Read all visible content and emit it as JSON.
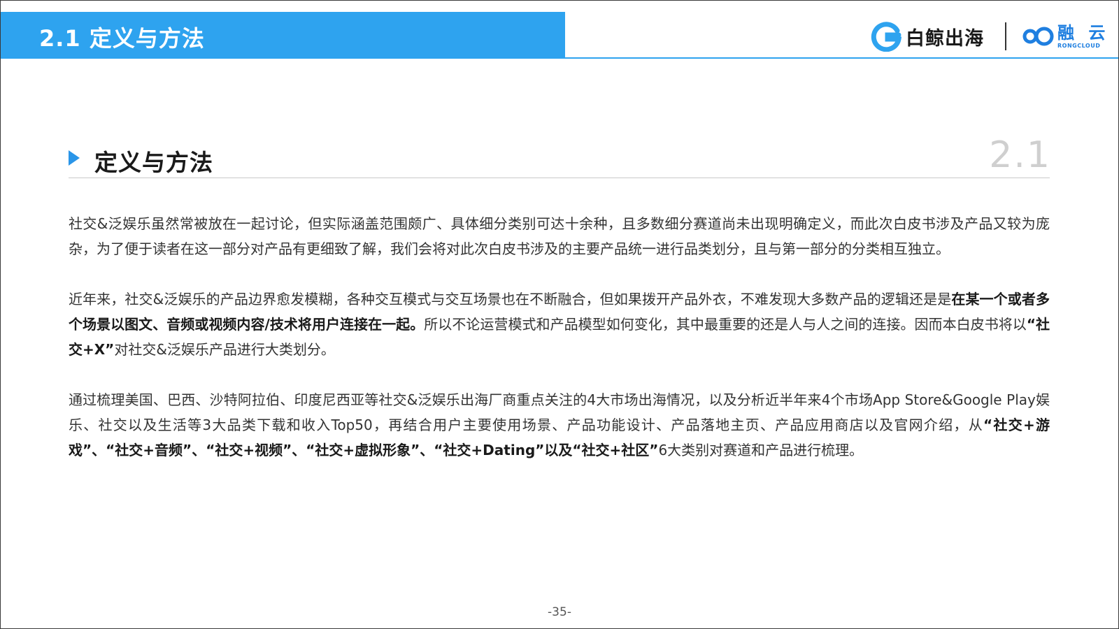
{
  "header": {
    "title": "2.1 定义与方法",
    "logo_left": "白鲸出海",
    "logo_right_cn": "融 云",
    "logo_right_en": "RONGCLOUD"
  },
  "section": {
    "title": "定义与方法",
    "number": "2.1"
  },
  "paragraphs": [
    [
      {
        "t": "社交&泛娱乐虽然常被放在一起讨论，但实际涵盖范围颇广、具体细分类别可达十余种，且多数细分赛道尚未出现明确定义，而此次白皮书涉及产品又较为庞杂，为了便于读者在这一部分对产品有更细致了解，我们会将对此次白皮书涉及的主要产品统一进行品类划分，且与第一部分的分类相互独立。"
      }
    ],
    [
      {
        "t": "近年来，社交&泛娱乐的产品边界愈发模糊，各种交互模式与交互场景也在不断融合，但如果拨开产品外衣，不难发现大多数产品的逻辑还是是"
      },
      {
        "t": "在某一个或者多个场景以图文、音频或视频内容/技术将用户连接在一起。",
        "b": true
      },
      {
        "t": "所以不论运营模式和产品模型如何变化，其中最重要的还是人与人之间的连接。因而本白皮书将以"
      },
      {
        "t": "“社交+X”",
        "b": true
      },
      {
        "t": "对社交&泛娱乐产品进行大类划分。"
      }
    ],
    [
      {
        "t": "通过梳理美国、巴西、沙特阿拉伯、印度尼西亚等社交&泛娱乐出海厂商重点关注的4大市场出海情况，以及分析近半年来4个市场App Store&Google Play娱乐、社交以及生活等3大品类下载和收入Top50，再结合用户主要使用场景、产品功能设计、产品落地主页、产品应用商店以及官网介绍，从"
      },
      {
        "t": "“社交+游戏”、“社交+音频”、“社交+视频”、“社交+虚拟形象”、“社交+Dating”以及“社交+社区”",
        "b": true
      },
      {
        "t": "6大类别对赛道和产品进行梳理。"
      }
    ]
  ],
  "footer": {
    "page_number": "-35-"
  },
  "colors": {
    "accent": "#2ea3ef",
    "marker": "#2a95e8",
    "logo_blue": "#1f7fe0"
  }
}
